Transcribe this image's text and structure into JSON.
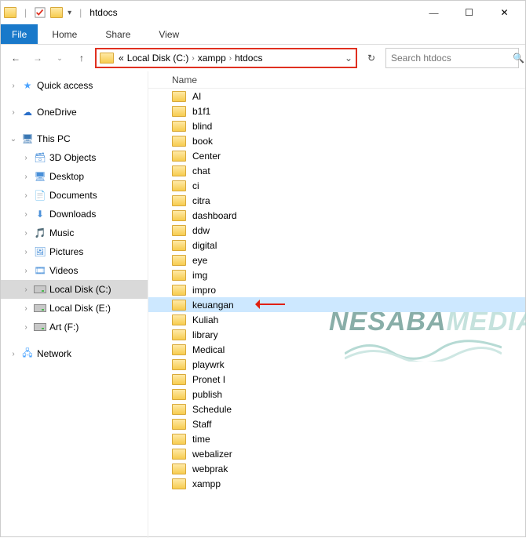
{
  "window": {
    "title": "htdocs"
  },
  "ribbon": {
    "file": "File",
    "tabs": [
      "Home",
      "Share",
      "View"
    ]
  },
  "nav": {
    "breadcrumb_laquo": "«",
    "breadcrumb": [
      "Local Disk (C:)",
      "xampp",
      "htdocs"
    ],
    "search_placeholder": "Search htdocs"
  },
  "tree": {
    "quick_access": "Quick access",
    "onedrive": "OneDrive",
    "this_pc": "This PC",
    "items": [
      "3D Objects",
      "Desktop",
      "Documents",
      "Downloads",
      "Music",
      "Pictures",
      "Videos",
      "Local Disk (C:)",
      "Local Disk (E:)",
      "Art (F:)"
    ],
    "network": "Network",
    "selected": "Local Disk (C:)"
  },
  "columns": {
    "name": "Name"
  },
  "files": [
    "AI",
    "b1f1",
    "blind",
    "book",
    "Center",
    "chat",
    "ci",
    "citra",
    "dashboard",
    "ddw",
    "digital",
    "eye",
    "img",
    "impro",
    "keuangan",
    "Kuliah",
    "library",
    "Medical",
    "playwrk",
    "Pronet I",
    "publish",
    "Schedule",
    "Staff",
    "time",
    "webalizer",
    "webprak",
    "xampp"
  ],
  "selected_file": "keuangan",
  "watermark": {
    "part1": "NESABA",
    "part2": "MEDIA"
  }
}
